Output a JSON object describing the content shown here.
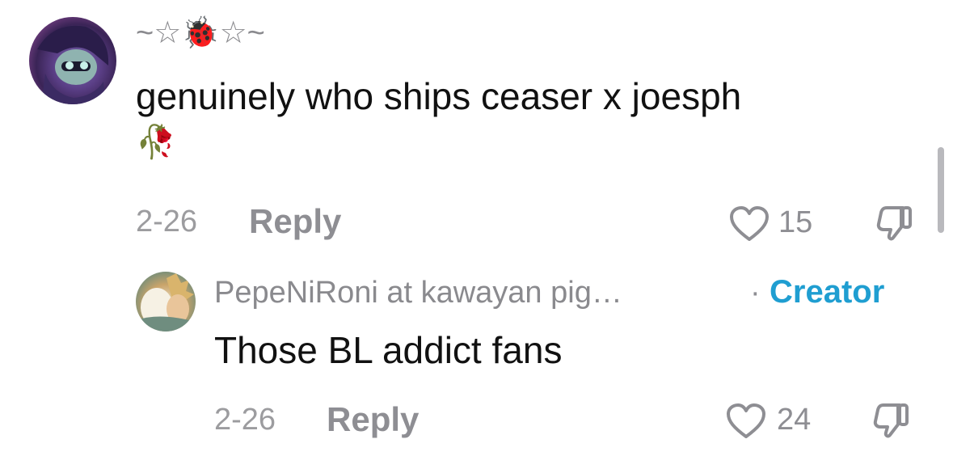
{
  "comments": [
    {
      "username": "~☆🐞☆~",
      "text": "genuinely who ships ceaser x joesph",
      "emoji": "🥀",
      "date": "2-26",
      "reply_label": "Reply",
      "likes": "15"
    },
    {
      "username": "PepeNiRoni at kawayan pig…",
      "separator": "·",
      "badge": "Creator",
      "text": "Those BL addict fans",
      "date": "2-26",
      "reply_label": "Reply",
      "likes": "24"
    }
  ],
  "colors": {
    "creator_badge": "#1f9ed1",
    "meta_text": "#8e8e93",
    "comment_text": "#111111"
  },
  "icons": [
    "heart-icon",
    "dislike-icon",
    "wilted-rose-emoji"
  ]
}
